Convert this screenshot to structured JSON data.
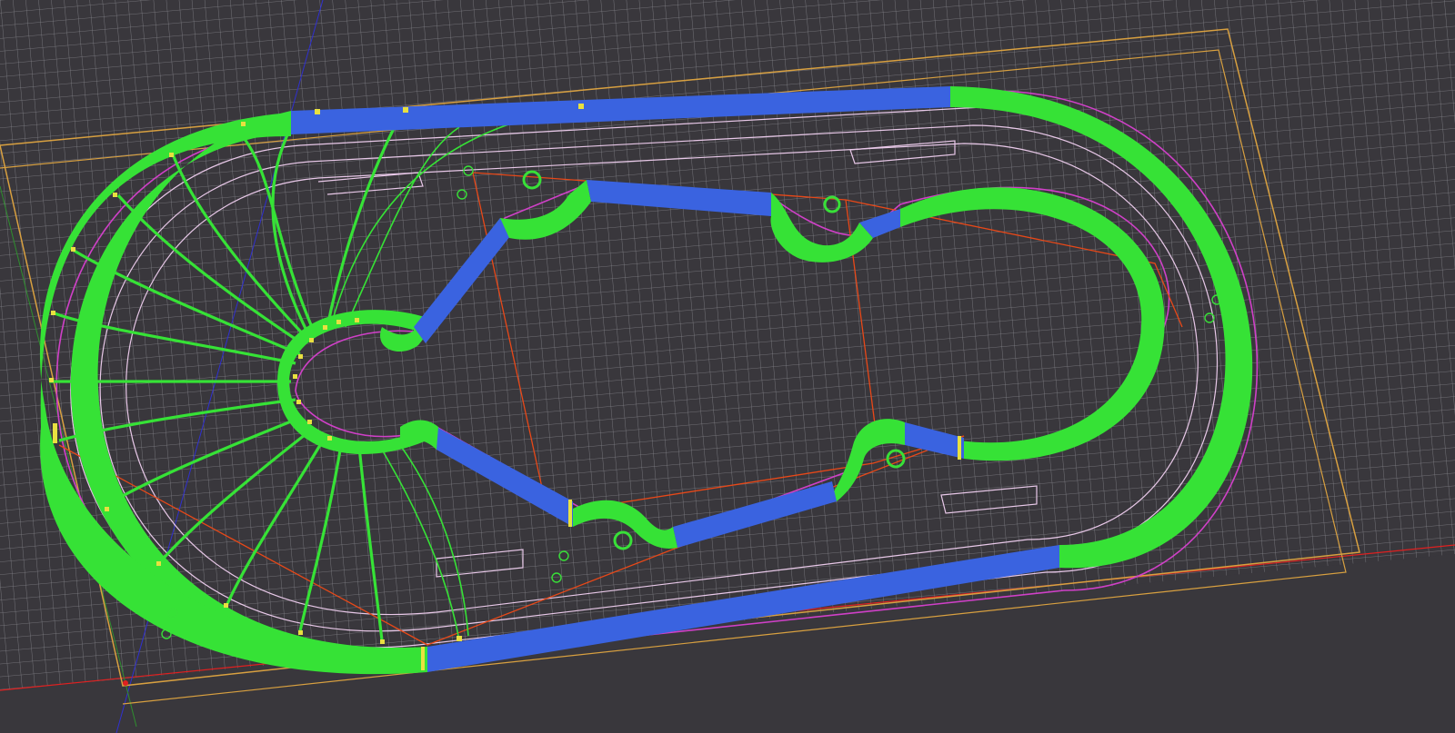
{
  "viewport": {
    "description_label": "",
    "background": "#39373c"
  },
  "colors": {
    "grid": "#8a8990",
    "grid_major": "#a3a2a8",
    "axis_x": "#e02020",
    "axis_y": "#2f8f2f",
    "axis_z": "#3030d0",
    "stock_outline": "#d8a040",
    "track_green": "#36e236",
    "track_blue": "#3a63e0",
    "magenta": "#d040c8",
    "pink_line": "#e8c8e8",
    "orange_line": "#e84818",
    "marker_yellow": "#e8e040",
    "circle_green": "#38e038"
  },
  "icons": [
    "axis-origin-icon",
    "marker-icon",
    "circle-marker-icon"
  ]
}
